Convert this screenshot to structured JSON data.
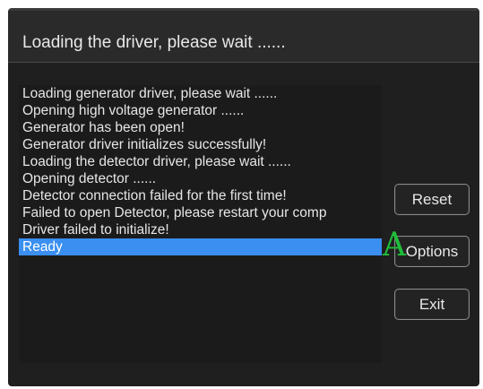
{
  "dialog": {
    "title": "Loading the driver, please wait ......"
  },
  "log": {
    "lines": [
      "Loading generator driver, please wait ......",
      "Opening high voltage generator ......",
      "Generator has been open!",
      "Generator driver initializes successfully!",
      "Loading the detector driver, please wait ......",
      "Opening detector ......",
      "Detector connection failed for the first time!",
      "Failed to open Detector, please restart your comp",
      "Driver failed to initialize!",
      "Ready"
    ],
    "selected_index": 9
  },
  "buttons": {
    "reset_label": "Reset",
    "options_label": "Options",
    "exit_label": "Exit"
  },
  "annotation": {
    "marker_text": "A"
  },
  "colors": {
    "selection": "#3a8ff0",
    "marker": "#1fbf3a",
    "background": "#1f1f1f"
  }
}
